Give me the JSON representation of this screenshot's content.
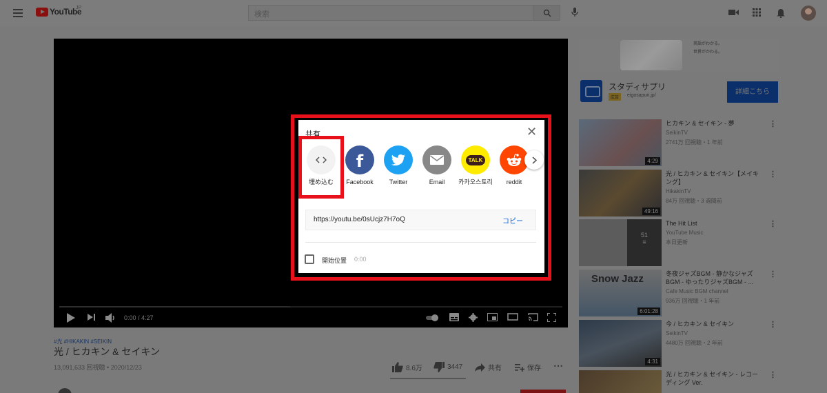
{
  "header": {
    "logo_text": "YouTube",
    "logo_suffix": "JP",
    "search_placeholder": "検索"
  },
  "player": {
    "time": "0:00 / 4:27"
  },
  "video": {
    "tags": "#光 #HIKAKIN #SEIKIN",
    "title": "光 / ヒカキン & セイキン",
    "views": "13,091,633 回視聴 • 2020/12/23",
    "likes": "8.6万",
    "dislikes": "3447",
    "share": "共有",
    "save": "保存"
  },
  "ad": {
    "banner_text_1": "英語がわかる。",
    "banner_text_2": "世界がかわる。",
    "title": "スタディサプリ",
    "badge": "広告",
    "url": "eigosapuri.jp/",
    "button": "詳細こちら"
  },
  "recommendations": [
    {
      "title": "ヒカキン & セイキン - 夢",
      "channel": "SeikinTV",
      "stats": "2741万 回視聴・1 年前",
      "duration": "4:29"
    },
    {
      "title": "光 / ヒカキン & セイキン【メイキング】",
      "channel": "HikakinTV",
      "stats": "84万 回視聴・3 週間前",
      "duration": "49:16"
    },
    {
      "title": "The Hit List",
      "channel": "YouTube Music",
      "stats": "本日更新",
      "count": "51"
    },
    {
      "title": "冬夜ジャズBGM - 静かなジャズBGM - ゆったりジャズBGM - ...",
      "channel": "Cafe Music BGM channel",
      "stats": "936万 回視聴・1 年前",
      "duration": "6:01:28",
      "thumb_text": "Snow Jazz"
    },
    {
      "title": "今 / ヒカキン & セイキン",
      "channel": "SeikinTV",
      "stats": "4480万 回視聴・2 年前",
      "duration": "4:31"
    },
    {
      "title": "光 / ヒカキン & セイキン - レコーディング Ver.",
      "channel": "",
      "stats": ""
    }
  ],
  "share_dialog": {
    "title": "共有",
    "items": [
      {
        "label": "埋め込む",
        "icon": "embed-icon",
        "color": "#f2f2f2"
      },
      {
        "label": "Facebook",
        "icon": "facebook-icon",
        "color": "#3b5998"
      },
      {
        "label": "Twitter",
        "icon": "twitter-icon",
        "color": "#1da1f2"
      },
      {
        "label": "Email",
        "icon": "email-icon",
        "color": "#888888"
      },
      {
        "label": "카카오스토리",
        "icon": "kakao-icon",
        "color": "#ffeb00"
      },
      {
        "label": "reddit",
        "icon": "reddit-icon",
        "color": "#ff4500"
      }
    ],
    "kakao_badge": "TALK",
    "url": "https://youtu.be/0sUcjz7H7oQ",
    "copy": "コピー",
    "start_label": "開始位置",
    "start_time": "0:00"
  },
  "colors": {
    "highlight": "#e8101a",
    "link_blue": "#065fd4"
  }
}
